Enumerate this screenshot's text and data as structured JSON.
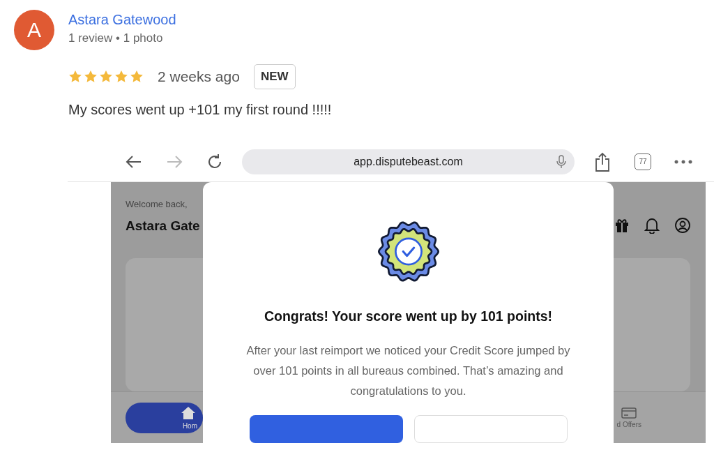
{
  "review": {
    "avatar_letter": "A",
    "author": "Astara Gatewood",
    "meta": "1 review • 1 photo",
    "stars": 5,
    "time": "2 weeks ago",
    "badge": "NEW",
    "text": "My scores went up +101 my first round !!!!!"
  },
  "screenshot": {
    "browser": {
      "url": "app.disputebeast.com",
      "tab_count": "77"
    },
    "app": {
      "greeting": "Welcome back,",
      "user_name": "Astara Gate",
      "nav": [
        {
          "label": "Hom",
          "selected": true
        },
        {
          "label": "d Offers",
          "selected": false
        }
      ]
    },
    "modal": {
      "title": "Congrats! Your score went up by 101 points!",
      "message": "After your last reimport we noticed your Credit Score jumped by over 101 points in all bureaus combined. That’s amazing and congratulations to you."
    }
  }
}
